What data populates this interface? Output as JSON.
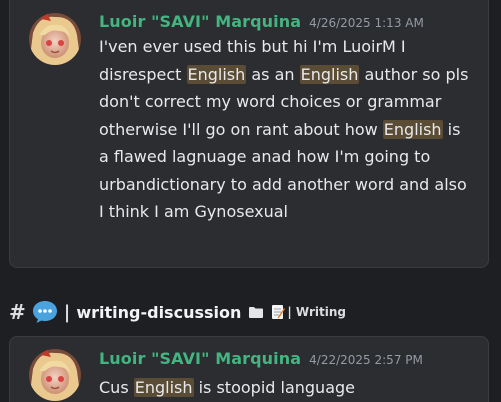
{
  "messages": [
    {
      "author": "Luoir \"SAVI\" Marquina",
      "timestamp": "4/26/2025 1:13 AM",
      "segments": [
        "I'ven ever used this but hi I'm LuoirM I disrespect ",
        "English",
        " as an ",
        "English",
        " author so pls don't correct my word choices or grammar otherwise I'll go on rant about how ",
        "English",
        " is a flawed lagnuage anad how I'm going to urbandictionary to add another word and also I think I am Gynosexual"
      ]
    },
    {
      "author": "Luoir \"SAVI\" Marquina",
      "timestamp": "4/22/2025 2:57 PM",
      "segments": [
        "Cus ",
        "English",
        " is stoopid language"
      ]
    }
  ],
  "channel": {
    "hash": "#",
    "icon": "speech-bubble-icon",
    "separator": "|",
    "name": "writing-discussion",
    "folder_icon": "folder-icon",
    "category_icon": "memo-icon",
    "category": "| Writing"
  },
  "colors": {
    "background": "#1e1f22",
    "card": "#2b2d31",
    "author": "#43b581",
    "timestamp": "#949ba4",
    "highlight": "#5b4d35",
    "bubble": "#4aa3df"
  }
}
